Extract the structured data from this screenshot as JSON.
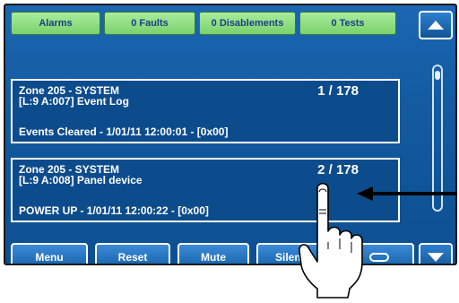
{
  "tabs": {
    "alarms": "Alarms",
    "faults": "0 Faults",
    "disablements": "0 Disablements",
    "tests": "0 Tests"
  },
  "events": [
    {
      "zone": "Zone 205 - SYSTEM",
      "location": "[L:9 A:007] Event Log",
      "count": "1 / 178",
      "detail": "Events Cleared  -  1/01/11 12:00:01 - [0x00]"
    },
    {
      "zone": "Zone 205 - SYSTEM",
      "location": "[L:9 A:008] Panel device",
      "count": "2 / 178",
      "detail": "POWER UP  -  1/01/11 12:00:22 - [0x00]"
    }
  ],
  "buttons": {
    "menu": "Menu",
    "reset": "Reset",
    "mute": "Mute",
    "silence": "Silence"
  },
  "icons": {
    "scroll_up": "triangle-up-icon",
    "scroll_down": "triangle-down-icon",
    "annotation_arrow": "left-arrow-icon",
    "touch": "pointing-hand-icon"
  },
  "colors": {
    "tab_green": "#79d26b",
    "tab_text": "#1e3d86",
    "panel_blue": "#135a9f",
    "text_white": "#ffffff"
  }
}
